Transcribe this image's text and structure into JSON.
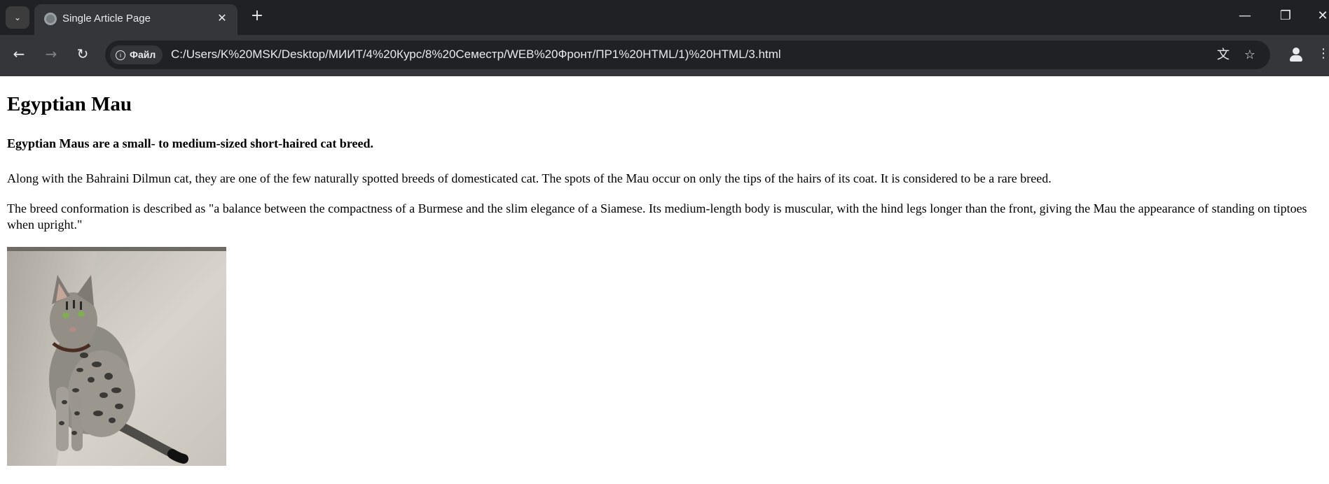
{
  "browser": {
    "tab_title": "Single Article Page",
    "site_chip_label": "Файл",
    "url": "C:/Users/K%20MSK/Desktop/МИИТ/4%20Курс/8%20Семестр/WEB%20Фронт/ПР1%20HTML/1)%20HTML/3.html",
    "icons": {
      "tab_menu": "chevron-down-icon",
      "tab_favicon": "globe-icon",
      "close": "close-icon",
      "new_tab": "plus-icon",
      "back": "arrow-left-icon",
      "forward": "arrow-right-icon",
      "reload": "reload-icon",
      "translate": "translate-icon",
      "bookmark": "star-icon",
      "profile": "profile-icon",
      "menu": "kebab-menu-icon"
    },
    "colors": {
      "frame": "#202124",
      "toolbar": "#35363a",
      "text": "#e8eaed"
    }
  },
  "article": {
    "title": "Egyptian Mau",
    "subtitle": "Egyptian Maus are a small- to medium-sized short-haired cat breed.",
    "paragraphs": [
      "Along with the Bahraini Dilmun cat, they are one of the few naturally spotted breeds of domesticated cat. The spots of the Mau occur on only the tips of the hairs of its coat. It is considered to be a rare breed.",
      "The breed conformation is described as \"a balance between the compactness of a Burmese and the slim elegance of a Siamese. Its medium-length body is muscular, with the hind legs longer than the front, giving the Mau the appearance of standing on tiptoes when upright.\""
    ]
  }
}
